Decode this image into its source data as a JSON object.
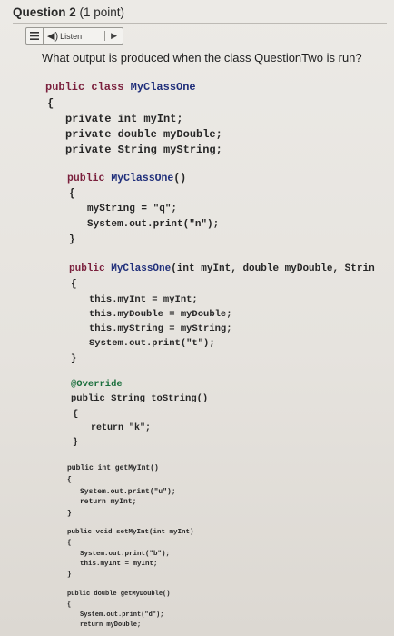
{
  "question": {
    "number_label": "Question 2",
    "points": "(1 point)",
    "prompt": "What output is produced when the class QuestionTwo is run?"
  },
  "listen": {
    "label": "Listen",
    "menu_icon": "menu-icon",
    "speaker_icon": "speaker-icon",
    "play_icon": "play-icon"
  },
  "code_lines": [
    "public class MyClassOne",
    "{",
    "private int myInt;",
    "private double myDouble;",
    "private String myString;",
    "public MyClassOne()",
    "{",
    "myString = \"q\";",
    "System.out.print(\"n\");",
    "}",
    "public MyClassOne(int myInt, double myDouble, Strin",
    "{",
    "this.myInt = myInt;",
    "this.myDouble = myDouble;",
    "this.myString = myString;",
    "System.out.print(\"t\");",
    "}",
    "@Override",
    "public String toString()",
    "{",
    "return \"k\";",
    "}",
    "public int getMyInt()",
    "{",
    "System.out.print(\"u\");",
    "return myInt;",
    "}",
    "public void setMyInt(int myInt)",
    "{",
    "System.out.print(\"b\");",
    "this.myInt = myInt;",
    "}",
    "public double getMyDouble()",
    "{",
    "System.out.print(\"d\");",
    "return myDouble;"
  ]
}
